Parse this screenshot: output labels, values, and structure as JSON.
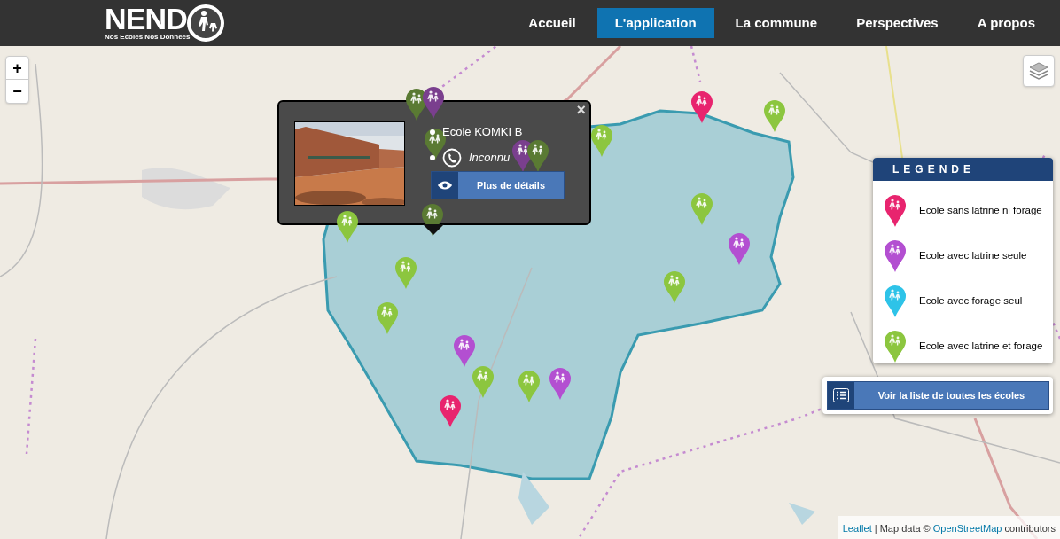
{
  "logo": {
    "text": "NEND",
    "tagline": "Nos Ecoles Nos Données"
  },
  "nav": [
    {
      "label": "Accueil",
      "selected": false
    },
    {
      "label": "L'application",
      "selected": true
    },
    {
      "label": "La commune",
      "selected": false
    },
    {
      "label": "Perspectives",
      "selected": false
    },
    {
      "label": "A propos",
      "selected": false
    }
  ],
  "zoom": {
    "in": "+",
    "out": "−"
  },
  "markers": [
    {
      "color": "#e8246e"
    },
    {
      "color": "#8cc63f"
    },
    {
      "color": "#8cc63f"
    },
    {
      "color": "#5a7a33"
    },
    {
      "color": "#7a3f8e"
    },
    {
      "color": "#5a7a33"
    },
    {
      "color": "#7a3f8e"
    },
    {
      "color": "#5a7a33"
    },
    {
      "color": "#8cc63f"
    },
    {
      "color": "#b34fd1"
    },
    {
      "color": "#8cc63f"
    },
    {
      "color": "#5a7a33"
    },
    {
      "color": "#8cc63f"
    },
    {
      "color": "#8cc63f"
    },
    {
      "color": "#8cc63f"
    },
    {
      "color": "#b34fd1"
    },
    {
      "color": "#8cc63f"
    },
    {
      "color": "#8cc63f"
    },
    {
      "color": "#b34fd1"
    },
    {
      "color": "#e8246e"
    }
  ],
  "popup": {
    "close": "×",
    "name": "Ecole KOMKI B",
    "phone": "Inconnu",
    "button": "Plus de détails"
  },
  "legend": {
    "title": "LEGENDE",
    "items": [
      {
        "label": "Ecole sans latrine ni forage",
        "color": "#e8246e"
      },
      {
        "label": "Ecole avec latrine seule",
        "color": "#b34fd1"
      },
      {
        "label": "Ecole avec forage seul",
        "color": "#2ec3e8"
      },
      {
        "label": "Ecole avec latrine et forage",
        "color": "#8cc63f"
      }
    ]
  },
  "list_button": "Voir la liste de toutes les écoles",
  "attribution": {
    "leaflet_link": "Leaflet",
    "separator": "|",
    "text": "Map data ©",
    "osm_link": "OpenStreetMap",
    "text_after": "contributors"
  }
}
